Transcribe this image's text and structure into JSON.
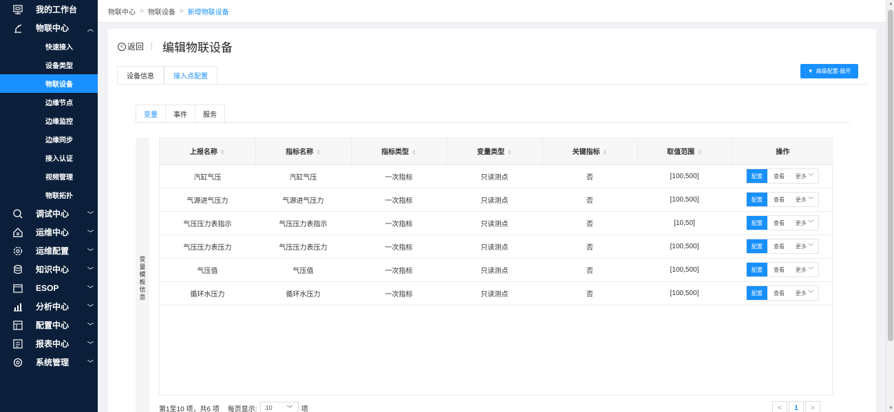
{
  "sidebar": {
    "workbench": "我的工作台",
    "iot_center": "物联中心",
    "sub_items": [
      "快速接入",
      "设备类型",
      "物联设备",
      "边缘节点",
      "边缘监控",
      "边缘同步",
      "接入认证",
      "视频管理",
      "物联拓扑"
    ],
    "active_sub": "物联设备",
    "groups": [
      "调试中心",
      "运维中心",
      "运维配置",
      "知识中心",
      "ESOP",
      "分析中心",
      "配置中心",
      "报表中心",
      "系统管理"
    ],
    "accent_color": "#1890ff",
    "bg_color": "#0b1f3a"
  },
  "breadcrumb": {
    "items": [
      "物联中心",
      "物联设备"
    ],
    "current": "新增物联设备"
  },
  "header": {
    "back_label": "返回",
    "title": "编辑物联设备",
    "advanced_button": "高级配置-展开"
  },
  "top_tabs": [
    "设备信息",
    "接入点配置"
  ],
  "inner_tabs": [
    "变量",
    "事件",
    "服务"
  ],
  "side_label": "变量模板信息",
  "table": {
    "columns": [
      "上报名称",
      "指标名称",
      "指标类型",
      "变量类型",
      "关键指标",
      "取值范围",
      "操作"
    ],
    "rows": [
      [
        "汽缸气压",
        "汽缸气压",
        "一次指标",
        "只读测点",
        "否",
        "[100,500]"
      ],
      [
        "气源进气压力",
        "气源进气压力",
        "一次指标",
        "只读测点",
        "否",
        "[100,500]"
      ],
      [
        "气压压力表指示",
        "气压压力表指示",
        "一次指标",
        "只读测点",
        "否",
        "[10,50]"
      ],
      [
        "气压压力表压力",
        "气压压力表压力",
        "一次指标",
        "只读测点",
        "否",
        "[100,500]"
      ],
      [
        "气压值",
        "气压值",
        "一次指标",
        "只读测点",
        "否",
        "[100,500]"
      ],
      [
        "循环水压力",
        "循环水压力",
        "一次指标",
        "只读测点",
        "否",
        "[100,500]"
      ]
    ],
    "op_config": "配置",
    "op_view": "查看",
    "op_more": "更多"
  },
  "pager": {
    "summary": "第1至10 项，共6 项",
    "per_page_label": "每页显示:",
    "per_page_value": "10",
    "unit": "项",
    "current_page": "1"
  }
}
